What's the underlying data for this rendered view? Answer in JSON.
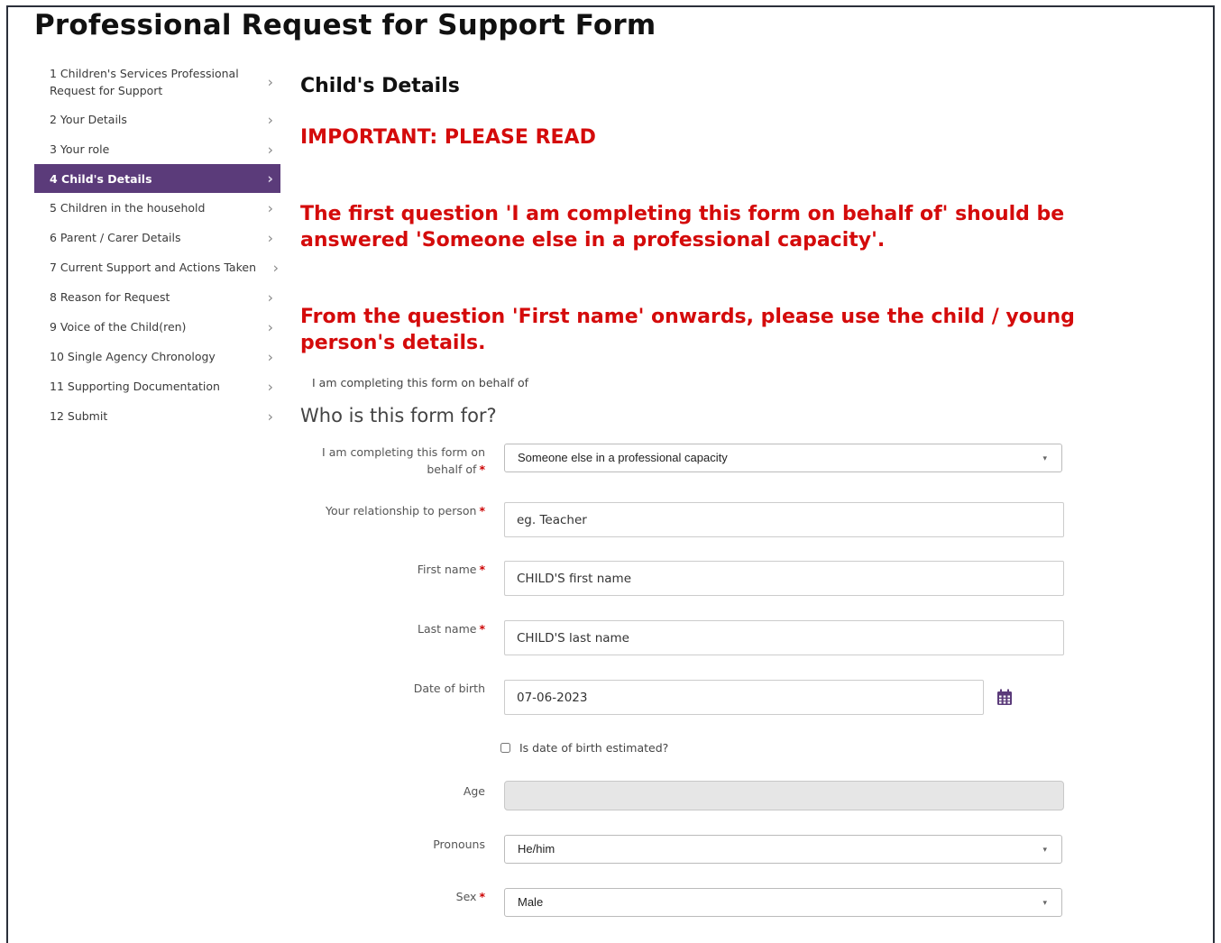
{
  "page_title": "Professional Request for Support Form",
  "sidebar": {
    "items": [
      {
        "label": "1 Children's Services Professional Request for Support",
        "active": false
      },
      {
        "label": "2 Your Details",
        "active": false
      },
      {
        "label": "3 Your role",
        "active": false
      },
      {
        "label": "4 Child's Details",
        "active": true
      },
      {
        "label": "5 Children in the household",
        "active": false
      },
      {
        "label": "6 Parent / Carer Details",
        "active": false
      },
      {
        "label": "7 Current Support and Actions Taken",
        "active": false
      },
      {
        "label": "8 Reason for Request",
        "active": false
      },
      {
        "label": "9 Voice of the Child(ren)",
        "active": false
      },
      {
        "label": "10 Single Agency Chronology",
        "active": false
      },
      {
        "label": "11 Supporting Documentation",
        "active": false
      },
      {
        "label": "12 Submit",
        "active": false
      }
    ],
    "chevron": "›"
  },
  "main": {
    "section_title": "Child's Details",
    "important_heading": "IMPORTANT: PLEASE READ",
    "notice_1": "The first question 'I am completing this form on behalf of' should be answered 'Someone else in a professional capacity'.",
    "notice_2": "From the question 'First name' onwards, please use the child / young person's details.",
    "small_label": "I am completing this form on behalf of",
    "sub_heading": "Who is this form for?",
    "fields": {
      "behalf_of": {
        "label": "I am completing this form on behalf of",
        "value": "Someone else in a professional capacity",
        "required": "*"
      },
      "relationship": {
        "label": "Your relationship to person",
        "placeholder": "eg. Teacher",
        "required": "*"
      },
      "first_name": {
        "label": "First name",
        "placeholder": "CHILD'S first name",
        "required": "*"
      },
      "last_name": {
        "label": "Last name",
        "placeholder": "CHILD'S last name",
        "required": "*"
      },
      "dob": {
        "label": "Date of birth",
        "value": "07-06-2023"
      },
      "dob_estimated": {
        "label": "Is date of birth estimated?",
        "checked": false
      },
      "age": {
        "label": "Age",
        "value": ""
      },
      "pronouns": {
        "label": "Pronouns",
        "value": "He/him"
      },
      "sex": {
        "label": "Sex",
        "value": "Male",
        "required": "*"
      }
    }
  },
  "icons": {
    "calendar": "calendar-icon",
    "caret": "▾"
  },
  "colors": {
    "accent": "#5b3b7a",
    "notice": "#d40b0b",
    "required": "#cc0000"
  }
}
